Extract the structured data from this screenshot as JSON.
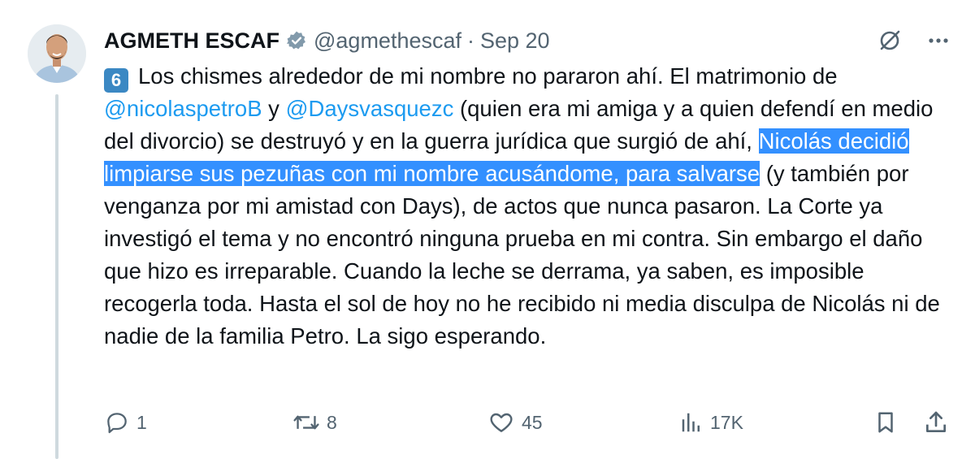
{
  "tweet": {
    "author_name": "AGMETH ESCAF",
    "handle": "@agmethescaf",
    "separator": "·",
    "date": "Sep 20",
    "number_emoji": "6",
    "text_part1": "Los chismes alrededor de mi nombre no pararon ahí. El matrimonio de ",
    "mention1": "@nicolaspetroB",
    "text_part2": " y ",
    "mention2": "@Daysvasquezc",
    "text_part3": " (quien era mi amiga y a quien defendí en medio del divorcio) se destruyó y en la guerra jurídica que surgió de ahí, ",
    "highlighted_text": "Nicolás decidió limpiarse sus pezuñas con mi nombre acusándome, para salvarse",
    "text_part4": " (y también por venganza por mi amistad con Days), de actos que nunca pasaron. La Corte ya investigó el tema y no encontró ninguna prueba en mi contra. Sin embargo el daño que hizo es irreparable. Cuando la leche se derrama, ya saben, es imposible recogerla toda. Hasta el sol de hoy no he recibido ni media disculpa de Nicolás ni de nadie de la familia Petro. La sigo esperando."
  },
  "icons": {
    "verified": "verified-badge-icon",
    "grok": "grok-icon",
    "more": "more-icon",
    "reply": "reply-icon",
    "retweet": "retweet-icon",
    "like": "heart-icon",
    "views": "views-icon",
    "bookmark": "bookmark-icon",
    "share": "share-icon"
  },
  "stats": {
    "replies": "1",
    "retweets": "8",
    "likes": "45",
    "views": "17K"
  },
  "colors": {
    "text": "#0f1419",
    "secondary": "#536471",
    "link": "#1d9bf0",
    "selection": "#3390ff",
    "keycap": "#3b88c3",
    "thread_line": "#cfd9de"
  }
}
